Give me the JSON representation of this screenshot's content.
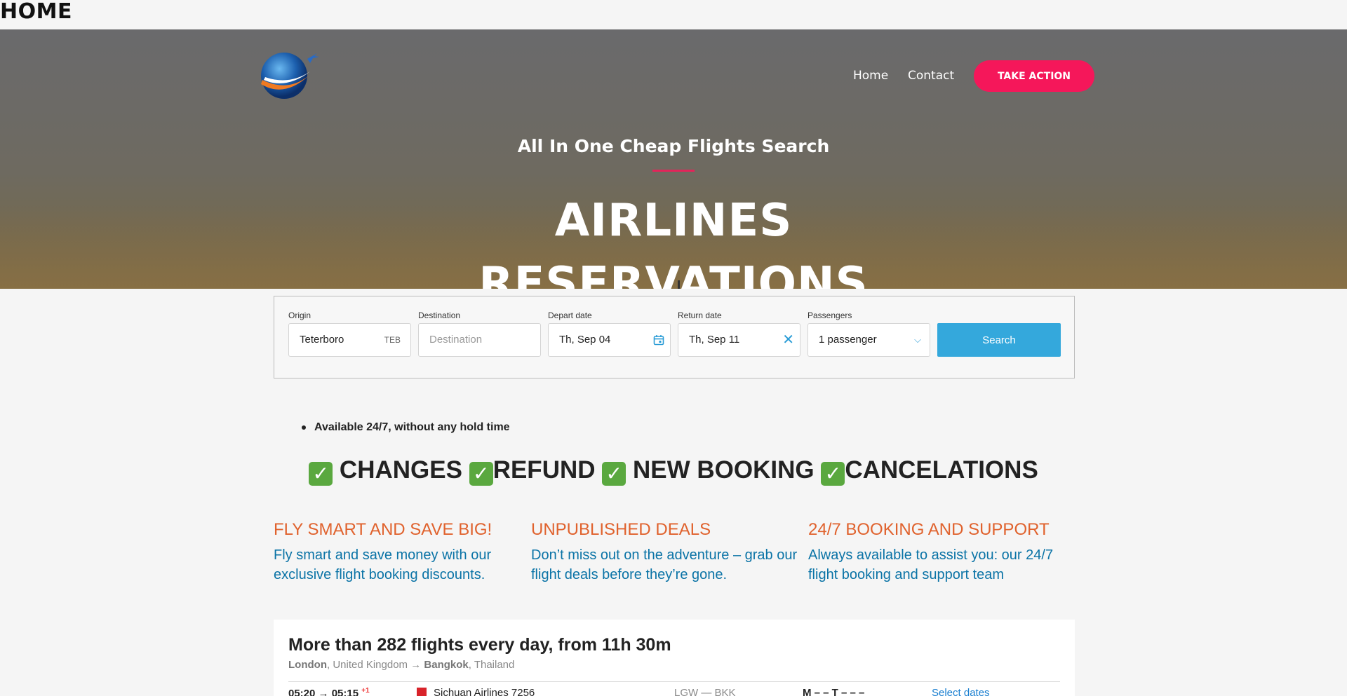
{
  "page": {
    "heading": "HOME"
  },
  "nav": {
    "home": "Home",
    "contact": "Contact",
    "cta": "TAKE ACTION"
  },
  "hero": {
    "subtitle": "All In One Cheap Flights Search",
    "title_line1": "AIRLINES",
    "title_line2": "RESERVATIONS"
  },
  "search": {
    "origin_label": "Origin",
    "origin_value": "Teterboro",
    "origin_code": "TEB",
    "destination_label": "Destination",
    "destination_placeholder": "Destination",
    "depart_label": "Depart date",
    "depart_value": "Th, Sep 04",
    "return_label": "Return date",
    "return_value": "Th, Sep 11",
    "passengers_label": "Passengers",
    "passengers_value": "1 passenger",
    "button": "Search"
  },
  "bullet": "Available 24/7, without any hold time",
  "features": [
    "CHANGES",
    "REFUND",
    "NEW BOOKING",
    "CANCELATIONS"
  ],
  "columns": [
    {
      "title": "FLY SMART AND SAVE BIG!",
      "text": "Fly smart and save money with our exclusive flight booking discounts."
    },
    {
      "title": "UNPUBLISHED DEALS",
      "text": "Don’t miss out on the adventure – grab our flight deals before they’re gone."
    },
    {
      "title": "24/7 BOOKING AND SUPPORT",
      "text": "Always available to assist you: our 24/7 flight booking and support team"
    }
  ],
  "flights": {
    "heading": "More than 282 flights every day, from 11h 30m",
    "from_city": "London",
    "from_country": ", United Kingdom → ",
    "to_city": "Bangkok",
    "to_country": ", Thailand",
    "row": {
      "times": "05:20 → 05:15",
      "plus": "+1",
      "airline": "Sichuan Airlines 7256",
      "route": "LGW — BKK",
      "days": "M – – T – – –",
      "link": "Select dates"
    }
  },
  "colors": {
    "accent": "#f5175a",
    "search_blue": "#34a8dc",
    "orange": "#e0622d",
    "link_blue": "#0a73a6"
  }
}
